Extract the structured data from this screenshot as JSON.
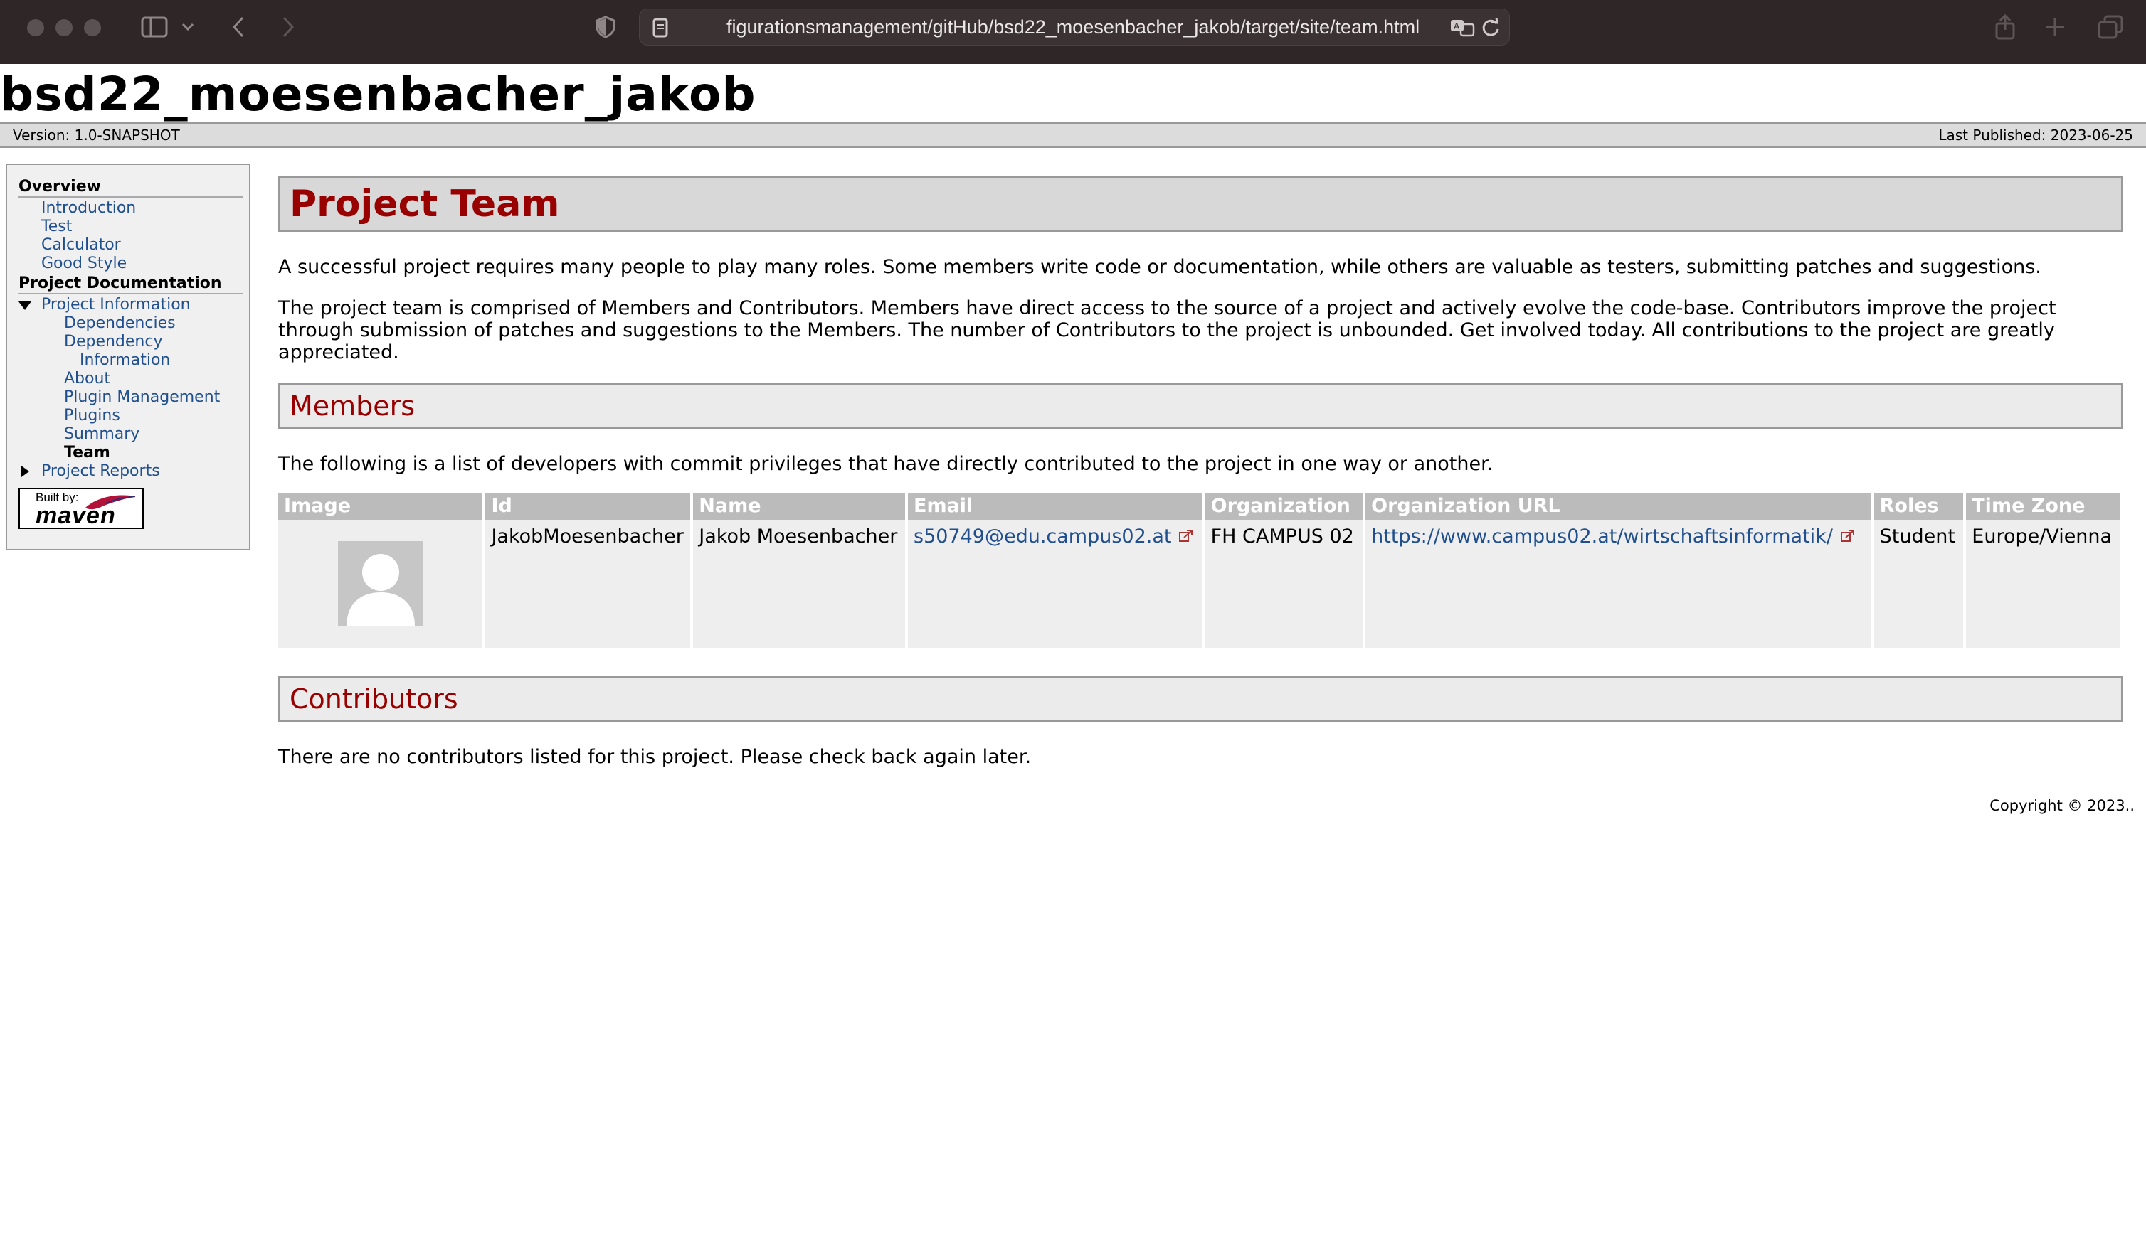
{
  "browser": {
    "url": "figurationsmanagement/gitHub/bsd22_moesenbacher_jakob/target/site/team.html"
  },
  "site": {
    "banner": "bsd22_moesenbacher_jakob",
    "version": "Version: 1.0-SNAPSHOT",
    "last_published": "Last Published: 2023-06-25"
  },
  "sidebar": {
    "overview_heading": "Overview",
    "overview_items": [
      "Introduction",
      "Test",
      "Calculator",
      "Good Style"
    ],
    "docs_heading": "Project Documentation",
    "project_information": "Project Information",
    "info_items": {
      "dependencies": "Dependencies",
      "dependency_information_1": "Dependency",
      "dependency_information_2": "Information",
      "about": "About",
      "plugin_management": "Plugin Management",
      "plugins": "Plugins",
      "summary": "Summary",
      "team": "Team"
    },
    "project_reports": "Project Reports",
    "built_by_small": "Built by:",
    "built_by_big": "maven"
  },
  "main": {
    "title": "Project Team",
    "intro_1": "A successful project requires many people to play many roles. Some members write code or documentation, while others are valuable as testers, submitting patches and suggestions.",
    "intro_2": "The project team is comprised of Members and Contributors. Members have direct access to the source of a project and actively evolve the code-base. Contributors improve the project through submission of patches and suggestions to the Members. The number of Contributors to the project is unbounded. Get involved today. All contributions to the project are greatly appreciated.",
    "members_heading": "Members",
    "members_text": "The following is a list of developers with commit privileges that have directly contributed to the project in one way or another.",
    "table": {
      "headers": [
        "Image",
        "Id",
        "Name",
        "Email",
        "Organization",
        "Organization URL",
        "Roles",
        "Time Zone"
      ],
      "rows": [
        {
          "id": "JakobMoesenbacher",
          "name": "Jakob Moesenbacher",
          "email": "s50749@edu.campus02.at",
          "organization": "FH CAMPUS 02",
          "organization_url": "https://www.campus02.at/wirtschaftsinformatik/",
          "roles": "Student",
          "time_zone": "Europe/Vienna"
        }
      ]
    },
    "contributors_heading": "Contributors",
    "contributors_text": "There are no contributors listed for this project. Please check back again later."
  },
  "footer": {
    "copyright": "Copyright © 2023.."
  },
  "colors": {
    "heading_red": "#990000",
    "link_blue": "#1f4f8f",
    "chrome_bg": "#2f2627"
  }
}
